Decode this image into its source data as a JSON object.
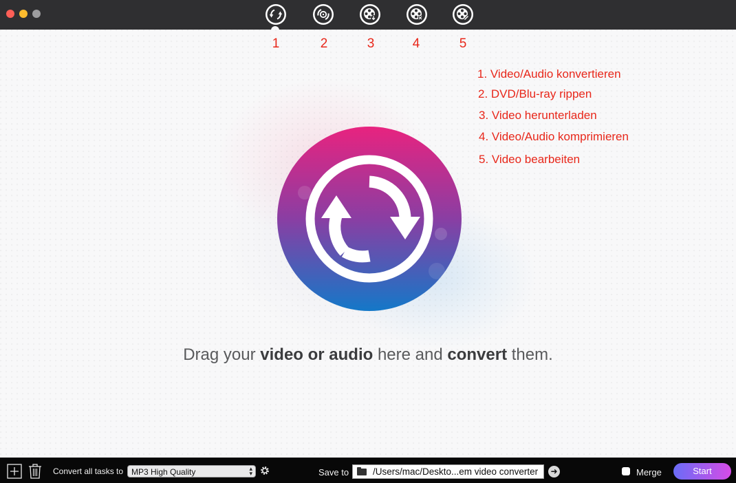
{
  "window": {
    "traffic_lights": [
      "close",
      "minimize",
      "zoom"
    ]
  },
  "toolbar": {
    "tabs": [
      {
        "name": "convert-tab",
        "icon": "convert-arrows-icon",
        "number": "1"
      },
      {
        "name": "rip-tab",
        "icon": "disc-rip-icon",
        "number": "2"
      },
      {
        "name": "download-tab",
        "icon": "film-reel-download-icon",
        "number": "3"
      },
      {
        "name": "compress-tab",
        "icon": "film-reel-compress-icon",
        "number": "4"
      },
      {
        "name": "edit-tab",
        "icon": "film-reel-edit-icon",
        "number": "5"
      }
    ]
  },
  "annotations": [
    "1. Video/Audio konvertieren",
    "2. DVD/Blu-ray rippen",
    "3. Video herunterladen",
    "4. Video/Audio komprimieren",
    "5. Video bearbeiten"
  ],
  "main": {
    "logo_icon": "convert-circle-logo-icon",
    "drag_text": {
      "part1": "Drag your ",
      "bold1": "video or audio",
      "part2": " here and ",
      "bold2": "convert",
      "part3": " them."
    }
  },
  "bottombar": {
    "convert_all_label": "Convert all tasks to",
    "format_selected": "MP3 High Quality",
    "save_to_label": "Save to",
    "save_path": "/Users/mac/Deskto...em video converter",
    "merge_label": "Merge",
    "merge_checked": false,
    "start_label": "Start"
  },
  "colors": {
    "annotation": "#e8271a",
    "titlebar": "#2f2f31",
    "bottombar": "#080808",
    "start_gradient": [
      "#6a6cf6",
      "#d64ce6"
    ]
  }
}
